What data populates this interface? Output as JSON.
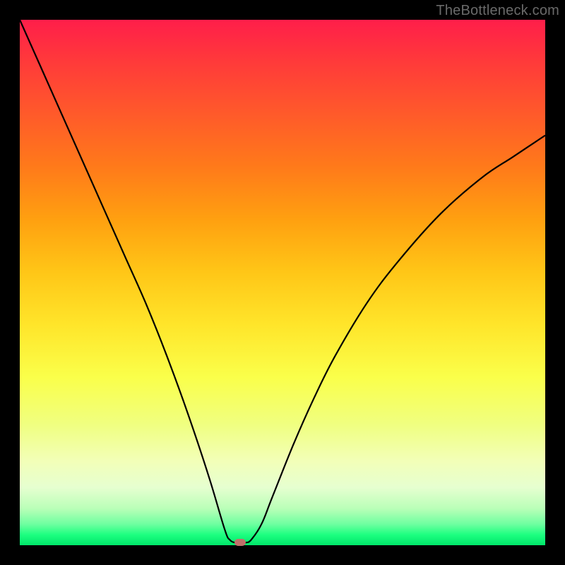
{
  "watermark": "TheBottleneck.com",
  "chart_data": {
    "type": "line",
    "title": "",
    "xlabel": "",
    "ylabel": "",
    "xlim": [
      0,
      100
    ],
    "ylim": [
      0,
      100
    ],
    "x": [
      0,
      4,
      8,
      12,
      16,
      20,
      24,
      28,
      32,
      36,
      39,
      40,
      41,
      42,
      43,
      44,
      46,
      48,
      52,
      56,
      60,
      66,
      72,
      80,
      88,
      94,
      100
    ],
    "y": [
      100,
      91,
      82,
      73,
      64,
      55,
      46,
      36,
      25,
      13,
      3,
      1,
      0.5,
      0.5,
      0.5,
      1,
      4,
      9,
      19,
      28,
      36,
      46,
      54,
      63,
      70,
      74,
      78
    ],
    "marker": {
      "x": 42,
      "y": 0.5
    },
    "background": "red-to-green vertical gradient"
  }
}
